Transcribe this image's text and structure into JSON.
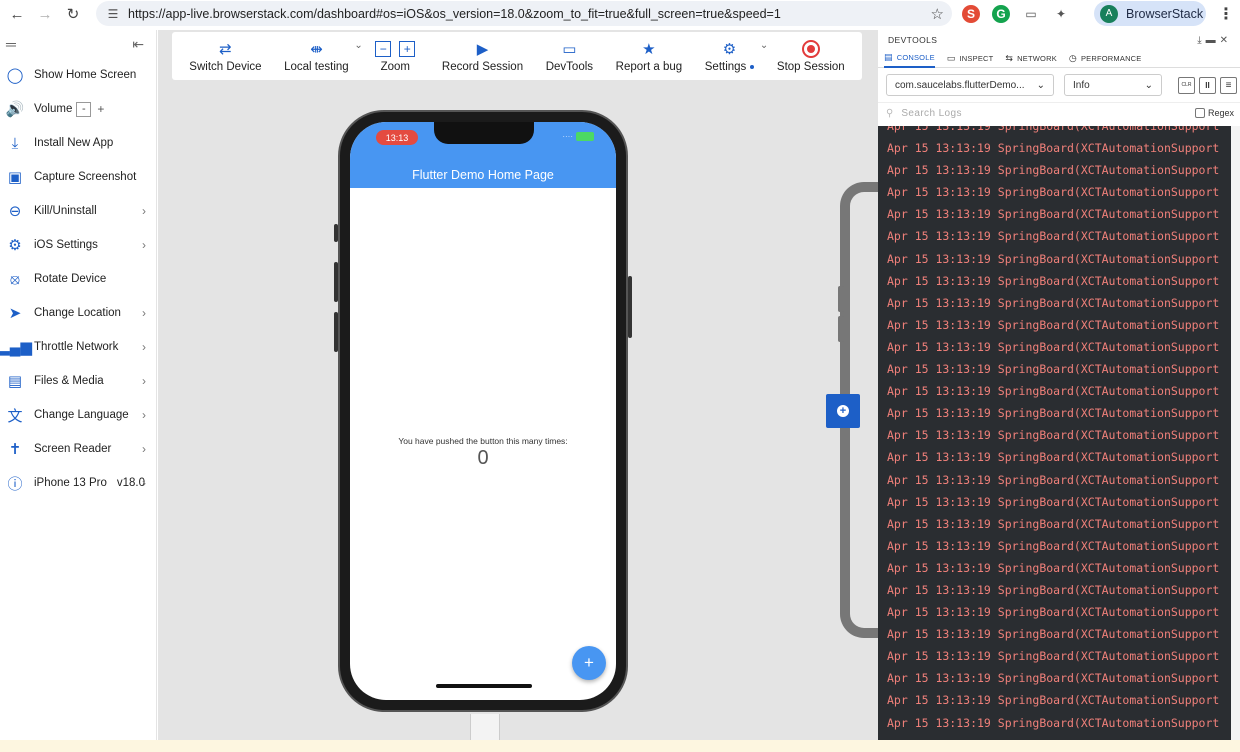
{
  "browser": {
    "url": "https://app-live.browserstack.com/dashboard#os=iOS&os_version=18.0&zoom_to_fit=true&full_screen=true&speed=1",
    "profile_name": "BrowserStack",
    "profile_initial": "A",
    "ext_s": "S",
    "ext_g": "G"
  },
  "sidebar": {
    "items": [
      {
        "label": "Show Home Screen",
        "icon": "circle-outline-icon"
      },
      {
        "label": "Volume",
        "icon": "volume-icon",
        "minus": "-",
        "plus": "+"
      },
      {
        "label": "Install New App",
        "icon": "download-icon"
      },
      {
        "label": "Capture Screenshot",
        "icon": "screenshot-icon"
      },
      {
        "label": "Kill/Uninstall",
        "icon": "minus-circle-icon"
      },
      {
        "label": "iOS Settings",
        "icon": "gear-icon"
      },
      {
        "label": "Rotate Device",
        "icon": "rotate-icon"
      },
      {
        "label": "Change Location",
        "icon": "location-arrow-icon"
      },
      {
        "label": "Throttle Network",
        "icon": "signal-bars-icon"
      },
      {
        "label": "Files & Media",
        "icon": "image-icon"
      },
      {
        "label": "Change Language",
        "icon": "translate-icon"
      },
      {
        "label": "Screen Reader",
        "icon": "accessibility-icon"
      },
      {
        "label": "iPhone 13 Pro",
        "icon": "info-icon",
        "extra": "v18.0"
      }
    ]
  },
  "toolbar": {
    "switch_device": "Switch Device",
    "local_testing": "Local testing",
    "zoom": "Zoom",
    "zoom_minus": "−",
    "zoom_plus": "+",
    "record_session": "Record Session",
    "devtools": "DevTools",
    "report_bug": "Report a bug",
    "settings": "Settings",
    "stop_session": "Stop Session"
  },
  "device": {
    "time": "13:13",
    "app_title": "Flutter Demo Home Page",
    "counter_text": "You have pushed the button this many times:",
    "counter_value": "0",
    "fab_label": "+"
  },
  "devtools": {
    "title": "DEVTOOLS",
    "tabs": [
      "CONSOLE",
      "INSPECT",
      "NETWORK",
      "PERFORMANCE"
    ],
    "app_select": "com.saucelabs.flutterDemo...",
    "level_select": "Info",
    "btn_clear": "CLR",
    "btn_pause": "II",
    "btn_wrap": "≡",
    "search_placeholder": "Search Logs",
    "regex_label": "Regex",
    "log_line": "Apr 15 13:13:19 SpringBoard(XCTAutomationSupport"
  },
  "colors": {
    "accent": "#1d5fc7",
    "app_bar": "#4896f2",
    "log_text": "#f0807a",
    "log_bg": "#2a2d31",
    "stop_red": "#e23b3b"
  }
}
